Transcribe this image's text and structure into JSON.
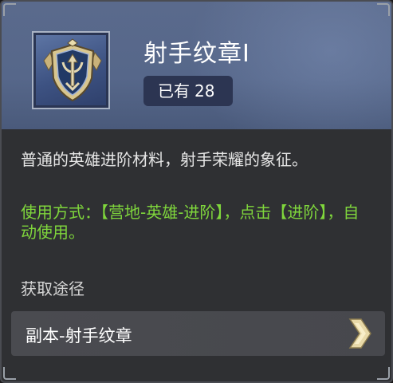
{
  "item": {
    "name": "射手纹章I",
    "owned_label": "已有",
    "owned_count": "28",
    "icon": "archer-crest-shield-icon"
  },
  "description": "普通的英雄进阶材料，射手荣耀的象征。",
  "usage": "使用方式：【营地-英雄-进阶】，点击【进阶】，自动使用。",
  "sources": {
    "title": "获取途径",
    "items": [
      {
        "label": "副本-射手纹章",
        "icon": "chevron-right-icon"
      }
    ]
  },
  "colors": {
    "header_bg": "#56678a",
    "panel_bg": "#2f3033",
    "usage_text": "#7fd63c",
    "chevron": "#e8d9a8"
  }
}
